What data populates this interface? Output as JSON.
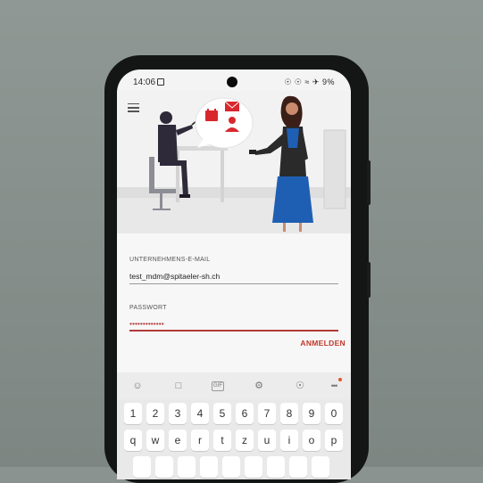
{
  "status_bar": {
    "time": "14:06",
    "indicators": "☉ ☉ ≈ ✈ 9%"
  },
  "illustration": {
    "icon_names": [
      "calendar-icon",
      "mail-icon",
      "contact-icon"
    ]
  },
  "form": {
    "email_label": "UNTERNEHMENS-E-MAIL",
    "email_value": "test_mdm@spitaeler-sh.ch",
    "password_label": "PASSWORT",
    "password_value": "•••••••••••••",
    "submit_label": "ANMELDEN"
  },
  "keyboard": {
    "toolbar_icons": [
      "emoji-icon",
      "sticker-icon",
      "gif-icon",
      "settings-icon",
      "microphone-icon",
      "more-icon"
    ],
    "gif_label": "GIF",
    "more_label": "•••",
    "row1": [
      "1",
      "2",
      "3",
      "4",
      "5",
      "6",
      "7",
      "8",
      "9",
      "0"
    ],
    "row2": [
      "q",
      "w",
      "e",
      "r",
      "t",
      "z",
      "u",
      "i",
      "o",
      "p"
    ]
  },
  "colors": {
    "accent": "#c0392b",
    "illustration_red": "#d9272e",
    "dress_blue": "#1f5fb3"
  }
}
